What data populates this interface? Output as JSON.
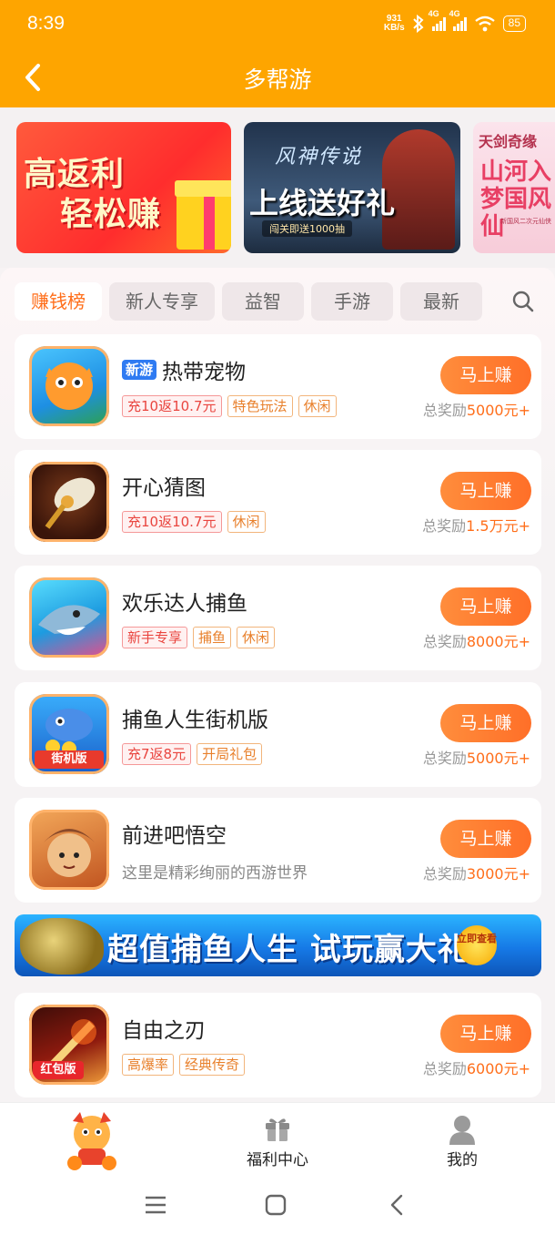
{
  "status_bar": {
    "time": "8:39",
    "net_speed_value": "931",
    "net_speed_unit": "KB/s",
    "signal1": "4G",
    "signal2": "4G",
    "battery": "85"
  },
  "header": {
    "title": "多帮游"
  },
  "banners": [
    {
      "line1": "高返利",
      "line2": "轻松赚"
    },
    {
      "logo": "风神传说",
      "headline": "上线送好礼",
      "sub": "闯关即送1000抽"
    },
    {
      "logo": "天剑奇缘",
      "headline": "山河入梦国风仙",
      "sub": "新国风二次元仙侠"
    }
  ],
  "tabs": [
    "赚钱榜",
    "新人专享",
    "益智",
    "手游",
    "最新"
  ],
  "games": [
    {
      "badge": "新游",
      "name": "热带宠物",
      "tags": [
        "充10返10.7元",
        "特色玩法",
        "休闲"
      ],
      "desc": "",
      "button": "马上赚",
      "reward_prefix": "总奖励",
      "reward": "5000元+"
    },
    {
      "badge": "",
      "name": "开心猜图",
      "tags": [
        "充10返10.7元",
        "休闲"
      ],
      "desc": "",
      "button": "马上赚",
      "reward_prefix": "总奖励",
      "reward": "1.5万元+"
    },
    {
      "badge": "",
      "name": "欢乐达人捕鱼",
      "tags": [
        "新手专享",
        "捕鱼",
        "休闲"
      ],
      "desc": "",
      "button": "马上赚",
      "reward_prefix": "总奖励",
      "reward": "8000元+"
    },
    {
      "badge": "",
      "name": "捕鱼人生街机版",
      "tags": [
        "充7返8元",
        "开局礼包"
      ],
      "desc": "",
      "button": "马上赚",
      "reward_prefix": "总奖励",
      "reward": "5000元+"
    },
    {
      "badge": "",
      "name": "前进吧悟空",
      "tags": [],
      "desc": "这里是精彩绚丽的西游世界",
      "button": "马上赚",
      "reward_prefix": "总奖励",
      "reward": "3000元+"
    },
    {
      "badge": "",
      "name": "自由之刃",
      "tags": [
        "高爆率",
        "经典传奇"
      ],
      "desc": "",
      "button": "马上赚",
      "reward_prefix": "总奖励",
      "reward": "6000元+"
    }
  ],
  "icon_labels": {
    "g4": "街机版",
    "g6": "红包版"
  },
  "ad_banner": {
    "text": "超值捕鱼人生 试玩赢大礼",
    "cta": "立即查看"
  },
  "bottom_nav": {
    "welfare": "福利中心",
    "mine": "我的"
  },
  "colors": {
    "header_bg": "#fea500",
    "accent": "#ff6e1a",
    "button": "#ff7a2e",
    "badge_blue": "#2f7bf2"
  }
}
